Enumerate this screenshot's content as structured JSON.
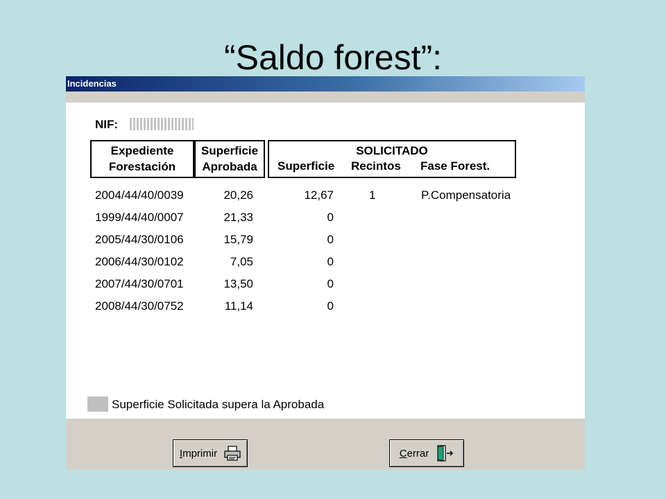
{
  "slide": {
    "title": "“Saldo forest”:"
  },
  "window": {
    "title": "Incidencias"
  },
  "nif": {
    "label": "NIF:"
  },
  "table": {
    "header": {
      "expediente": [
        "Expediente",
        "Forestación"
      ],
      "superficie_aprobada": [
        "Superficie",
        "Aprobada"
      ],
      "solicitado": "SOLICITADO",
      "superficie": "Superficie",
      "recintos": "Recintos",
      "fase": "Fase Forest."
    },
    "rows": [
      {
        "expediente": "2004/44/40/0039",
        "aprobada": "20,26",
        "superficie": "12,67",
        "recintos": "1",
        "fase": "P.Compensatoria"
      },
      {
        "expediente": "1999/44/40/0007",
        "aprobada": "21,33",
        "superficie": "0",
        "recintos": "",
        "fase": ""
      },
      {
        "expediente": "2005/44/30/0106",
        "aprobada": "15,79",
        "superficie": "0",
        "recintos": "",
        "fase": ""
      },
      {
        "expediente": "2006/44/30/0102",
        "aprobada": "7,05",
        "superficie": "0",
        "recintos": "",
        "fase": ""
      },
      {
        "expediente": "2007/44/30/0701",
        "aprobada": "13,50",
        "superficie": "0",
        "recintos": "",
        "fase": ""
      },
      {
        "expediente": "2008/44/30/0752",
        "aprobada": "11,14",
        "superficie": "0",
        "recintos": "",
        "fase": ""
      }
    ]
  },
  "legend": {
    "text": "Superficie Solicitada supera la Aprobada",
    "color": "#c0c0c0"
  },
  "buttons": {
    "imprimir": {
      "label_u": "I",
      "label_rest": "mprimir",
      "icon": "printer-icon"
    },
    "cerrar": {
      "label_u": "C",
      "label_rest": "errar",
      "icon": "exit-door-icon"
    }
  }
}
